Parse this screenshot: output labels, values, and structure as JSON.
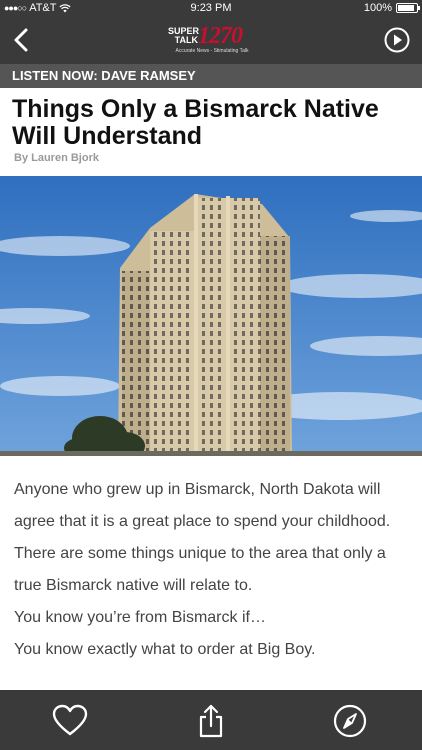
{
  "status_bar": {
    "carrier": "AT&T",
    "time": "9:23 PM",
    "battery": "100%",
    "battery_level": 1.0
  },
  "nav": {
    "logo": {
      "super_line1": "SUPER",
      "super_line2": "TALK",
      "number": "1270",
      "tagline": "Accurate News - Stimulating Talk"
    },
    "icons": {
      "back": "chevron-left-icon",
      "play": "play-circle-icon"
    }
  },
  "listen_bar": {
    "text": "LISTEN NOW: DAVE RAMSEY"
  },
  "article": {
    "title": "Things Only a Bismarck Native Will Understand",
    "byline": "By Lauren Bjork",
    "paragraphs": [
      "Anyone who grew up in Bismarck, North Dakota will agree that it is a great place to spend your childhood. There are some things unique to the area that only a true Bismarck native will relate to.",
      "You know you’re from Bismarck if…",
      "You know exactly what to order at Big Boy."
    ]
  },
  "bottom_bar": {
    "icons": [
      "heart-icon",
      "share-icon",
      "compass-icon"
    ]
  },
  "colors": {
    "bar_dark": "#3a3a3a",
    "listen_bar": "#555555",
    "logo_red": "#c8102e",
    "sky": "#3f7fc8"
  }
}
